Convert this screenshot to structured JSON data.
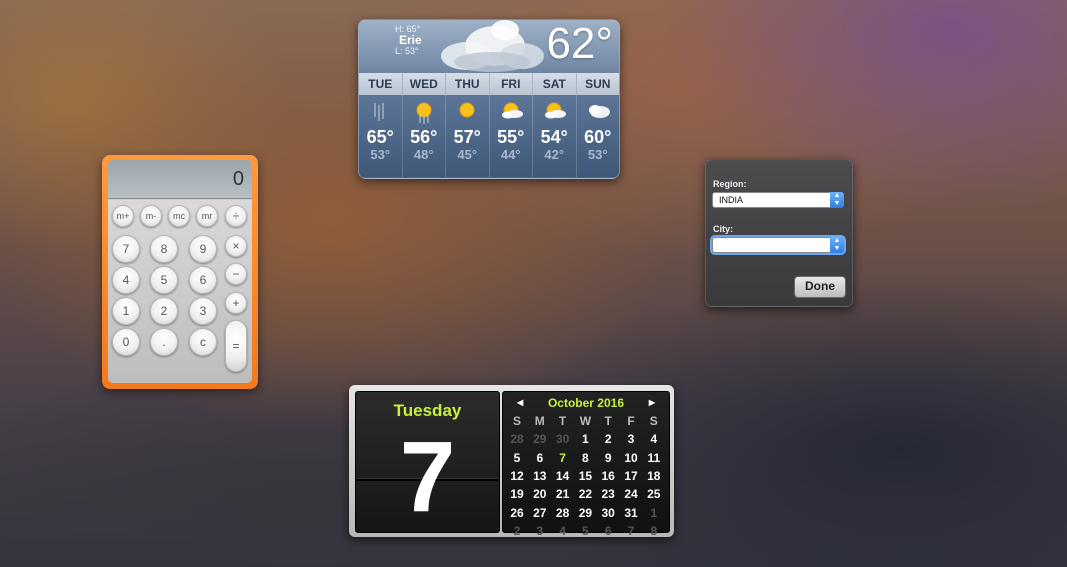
{
  "weather": {
    "city": "Erie",
    "high": "H: 65°",
    "low": "L: 53°",
    "current_temp": "62°",
    "forecast": [
      {
        "day": "TUE",
        "high": "65°",
        "low": "53°",
        "icon": "rain-icon"
      },
      {
        "day": "WED",
        "high": "56°",
        "low": "48°",
        "icon": "sun-rain-icon"
      },
      {
        "day": "THU",
        "high": "57°",
        "low": "45°",
        "icon": "sun-icon"
      },
      {
        "day": "FRI",
        "high": "55°",
        "low": "44°",
        "icon": "partly-cloudy-icon"
      },
      {
        "day": "SAT",
        "high": "54°",
        "low": "42°",
        "icon": "partly-cloudy-icon"
      },
      {
        "day": "SUN",
        "high": "60°",
        "low": "53°",
        "icon": "cloudy-icon"
      }
    ]
  },
  "calculator": {
    "display": "0",
    "memory_keys": [
      "m+",
      "m-",
      "mc",
      "mr"
    ],
    "number_keys": [
      "7",
      "8",
      "9",
      "4",
      "5",
      "6",
      "1",
      "2",
      "3",
      "0",
      ".",
      "c"
    ],
    "operator_keys": [
      "÷",
      "×",
      "−",
      "+",
      "="
    ]
  },
  "region": {
    "region_label": "Region:",
    "region_value": "INDIA",
    "city_label": "City:",
    "city_value": "",
    "done_label": "Done"
  },
  "calendar": {
    "weekday": "Tuesday",
    "day": "7",
    "month_title": "October 2016",
    "headers": [
      "S",
      "M",
      "T",
      "W",
      "T",
      "F",
      "S"
    ],
    "weeks": [
      [
        {
          "d": "28",
          "dim": true
        },
        {
          "d": "29",
          "dim": true
        },
        {
          "d": "30",
          "dim": true
        },
        {
          "d": "1"
        },
        {
          "d": "2"
        },
        {
          "d": "3"
        },
        {
          "d": "4"
        }
      ],
      [
        {
          "d": "5"
        },
        {
          "d": "6"
        },
        {
          "d": "7",
          "today": true
        },
        {
          "d": "8"
        },
        {
          "d": "9"
        },
        {
          "d": "10"
        },
        {
          "d": "11"
        }
      ],
      [
        {
          "d": "12"
        },
        {
          "d": "13"
        },
        {
          "d": "14"
        },
        {
          "d": "15"
        },
        {
          "d": "16"
        },
        {
          "d": "17"
        },
        {
          "d": "18"
        }
      ],
      [
        {
          "d": "19"
        },
        {
          "d": "20"
        },
        {
          "d": "21"
        },
        {
          "d": "22"
        },
        {
          "d": "23"
        },
        {
          "d": "24"
        },
        {
          "d": "25"
        }
      ],
      [
        {
          "d": "26"
        },
        {
          "d": "27"
        },
        {
          "d": "28"
        },
        {
          "d": "29"
        },
        {
          "d": "30"
        },
        {
          "d": "31"
        },
        {
          "d": "1",
          "dim": true
        }
      ],
      [
        {
          "d": "2",
          "dim": true
        },
        {
          "d": "3",
          "dim": true
        },
        {
          "d": "4",
          "dim": true
        },
        {
          "d": "5",
          "dim": true
        },
        {
          "d": "6",
          "dim": true
        },
        {
          "d": "7",
          "dim": true
        },
        {
          "d": "8",
          "dim": true
        }
      ]
    ]
  },
  "colors": {
    "calendar_accent": "#c7f23b",
    "calculator_frame": "#f47a1c",
    "select_arrow": "#2e7ee2"
  }
}
